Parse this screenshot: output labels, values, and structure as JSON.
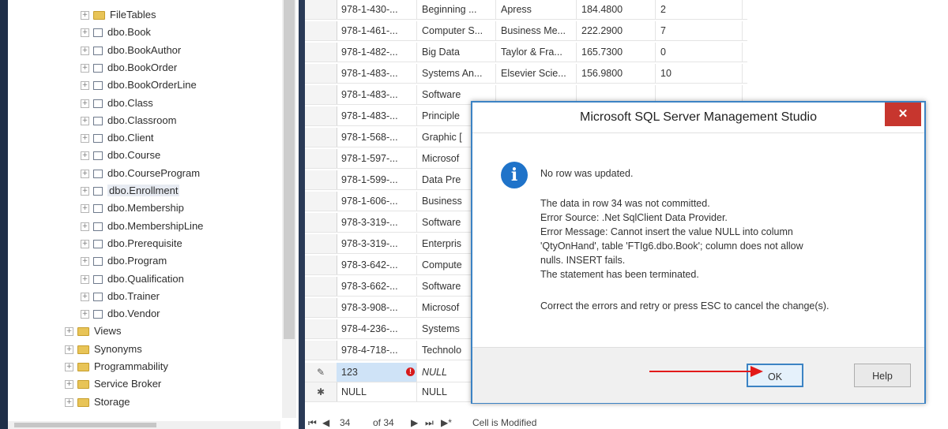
{
  "explorer": {
    "items": [
      {
        "label": "FileTables",
        "kind": "folder"
      },
      {
        "label": "dbo.Book",
        "kind": "table"
      },
      {
        "label": "dbo.BookAuthor",
        "kind": "table"
      },
      {
        "label": "dbo.BookOrder",
        "kind": "table"
      },
      {
        "label": "dbo.BookOrderLine",
        "kind": "table"
      },
      {
        "label": "dbo.Class",
        "kind": "table"
      },
      {
        "label": "dbo.Classroom",
        "kind": "table"
      },
      {
        "label": "dbo.Client",
        "kind": "table"
      },
      {
        "label": "dbo.Course",
        "kind": "table"
      },
      {
        "label": "dbo.CourseProgram",
        "kind": "table"
      },
      {
        "label": "dbo.Enrollment",
        "kind": "table"
      },
      {
        "label": "dbo.Membership",
        "kind": "table"
      },
      {
        "label": "dbo.MembershipLine",
        "kind": "table"
      },
      {
        "label": "dbo.Prerequisite",
        "kind": "table"
      },
      {
        "label": "dbo.Program",
        "kind": "table"
      },
      {
        "label": "dbo.Qualification",
        "kind": "table"
      },
      {
        "label": "dbo.Trainer",
        "kind": "table"
      },
      {
        "label": "dbo.Vendor",
        "kind": "table"
      },
      {
        "label": "Views",
        "kind": "folder"
      },
      {
        "label": "Synonyms",
        "kind": "folder"
      },
      {
        "label": "Programmability",
        "kind": "folder"
      },
      {
        "label": "Service Broker",
        "kind": "folder"
      },
      {
        "label": "Storage",
        "kind": "folder"
      }
    ]
  },
  "grid": {
    "rows": [
      {
        "c1": "978-1-430-...",
        "c2": "Beginning ...",
        "c3": "Apress",
        "c4": "184.4800",
        "c5": "2"
      },
      {
        "c1": "978-1-461-...",
        "c2": "Computer S...",
        "c3": "Business Me...",
        "c4": "222.2900",
        "c5": "7"
      },
      {
        "c1": "978-1-482-...",
        "c2": "Big Data",
        "c3": "Taylor & Fra...",
        "c4": "165.7300",
        "c5": "0"
      },
      {
        "c1": "978-1-483-...",
        "c2": "Systems An...",
        "c3": "Elsevier Scie...",
        "c4": "156.9800",
        "c5": "10"
      },
      {
        "c1": "978-1-483-...",
        "c2": "Software",
        "c3": "",
        "c4": "",
        "c5": ""
      },
      {
        "c1": "978-1-483-...",
        "c2": "Principle",
        "c3": "",
        "c4": "",
        "c5": ""
      },
      {
        "c1": "978-1-568-...",
        "c2": "Graphic [",
        "c3": "",
        "c4": "",
        "c5": ""
      },
      {
        "c1": "978-1-597-...",
        "c2": "Microsof",
        "c3": "",
        "c4": "",
        "c5": ""
      },
      {
        "c1": "978-1-599-...",
        "c2": "Data Pre",
        "c3": "",
        "c4": "",
        "c5": ""
      },
      {
        "c1": "978-1-606-...",
        "c2": "Business",
        "c3": "",
        "c4": "",
        "c5": ""
      },
      {
        "c1": "978-3-319-...",
        "c2": "Software",
        "c3": "",
        "c4": "",
        "c5": ""
      },
      {
        "c1": "978-3-319-...",
        "c2": "Enterpris",
        "c3": "",
        "c4": "",
        "c5": ""
      },
      {
        "c1": "978-3-642-...",
        "c2": "Compute",
        "c3": "",
        "c4": "",
        "c5": ""
      },
      {
        "c1": "978-3-662-...",
        "c2": "Software",
        "c3": "",
        "c4": "",
        "c5": ""
      },
      {
        "c1": "978-3-908-...",
        "c2": "Microsof",
        "c3": "",
        "c4": "",
        "c5": ""
      },
      {
        "c1": "978-4-236-...",
        "c2": "Systems",
        "c3": "",
        "c4": "",
        "c5": ""
      },
      {
        "c1": "978-4-718-...",
        "c2": "Technolo",
        "c3": "",
        "c4": "",
        "c5": ""
      }
    ],
    "edit_row": {
      "marker": "✎",
      "c1": "123",
      "c2": "NULL",
      "error_glyph": "!"
    },
    "new_row": {
      "marker": "✱",
      "c1": "NULL",
      "c2": "NULL"
    }
  },
  "navbar": {
    "first": "⏮",
    "prev": "◀",
    "current": "34",
    "of_text": "of 34",
    "next": "▶",
    "last": "⏭",
    "new": "▶*",
    "status": "Cell is Modified"
  },
  "dialog": {
    "title": "Microsoft SQL Server Management Studio",
    "close": "✕",
    "icon": "i",
    "lines": [
      "No row was updated.",
      "The data in row 34 was not committed.",
      "Error Source: .Net SqlClient Data Provider.",
      "Error Message: Cannot insert the value NULL into column",
      "'QtyOnHand', table 'FTIg6.dbo.Book'; column does not allow",
      "nulls. INSERT fails.",
      "The statement has been terminated.",
      "Correct the errors and retry or press ESC to cancel the change(s)."
    ],
    "ok_label": "OK",
    "help_label": "Help"
  },
  "colors": {
    "annotation_arrow": "#e21a1a",
    "title_close": "#c7362e",
    "accent": "#3c83c4"
  }
}
